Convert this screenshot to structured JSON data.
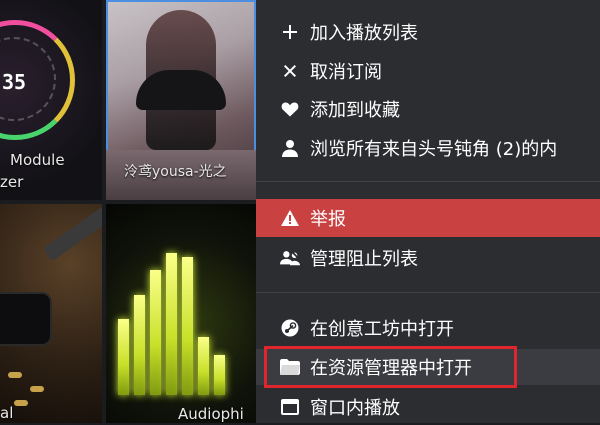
{
  "tiles": {
    "visualizer": {
      "number": "35",
      "label_line1": "Module",
      "label_line2": "zer"
    },
    "anime": {
      "label": "泠鸢yousa-光之"
    },
    "leather": {
      "label": "al"
    },
    "audio": {
      "label": "Audiophi"
    }
  },
  "context_menu": {
    "items": [
      {
        "label": "加入播放列表",
        "icon": "plus-icon"
      },
      {
        "label": "取消订阅",
        "icon": "x-icon"
      },
      {
        "label": "添加到收藏",
        "icon": "heart-icon"
      },
      {
        "label": "浏览所有来自头号钝角 (2)的内",
        "icon": "user-icon"
      },
      {
        "label": "举报",
        "icon": "warning-icon",
        "style": "danger"
      },
      {
        "label": "管理阻止列表",
        "icon": "block-users-icon"
      },
      {
        "label": "在创意工坊中打开",
        "icon": "steam-icon"
      },
      {
        "label": "在资源管理器中打开",
        "icon": "folder-icon",
        "state": "hovered",
        "annotated": true
      },
      {
        "label": "窗口内播放",
        "icon": "window-icon"
      }
    ]
  },
  "colors": {
    "menu_bg": "#2b2d31",
    "danger": "#c94141",
    "hover": "#3a3c41",
    "annotation": "#e0262d",
    "selection": "#4c8fe0"
  }
}
